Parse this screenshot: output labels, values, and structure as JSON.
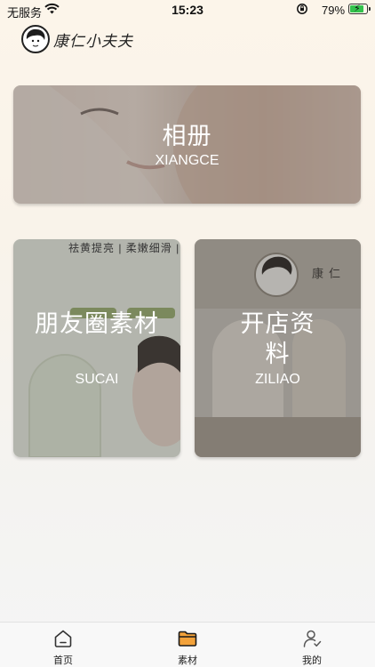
{
  "status_bar": {
    "carrier": "无服务",
    "time": "15:23",
    "battery_percent": "79%",
    "battery_level": 0.79,
    "icons": [
      "wifi-icon",
      "rotation-lock-icon",
      "battery-charging-icon"
    ]
  },
  "header": {
    "logo_text": "康仁小夫夫"
  },
  "cards": [
    {
      "title": "相册",
      "subtitle": "XIANGCE"
    },
    {
      "title": "朋友圈素材",
      "subtitle": "SUCAI",
      "image_text": [
        "祛黄提亮 | 柔嫩细滑 |"
      ]
    },
    {
      "title": "开店资料",
      "subtitle": "ZILIAO",
      "image_text": [
        "康仁"
      ]
    }
  ],
  "tab_bar": {
    "tabs": [
      {
        "label": "首页",
        "icon": "home-icon"
      },
      {
        "label": "素材",
        "icon": "folder-icon",
        "active": true
      },
      {
        "label": "我的",
        "icon": "user-icon"
      }
    ]
  }
}
